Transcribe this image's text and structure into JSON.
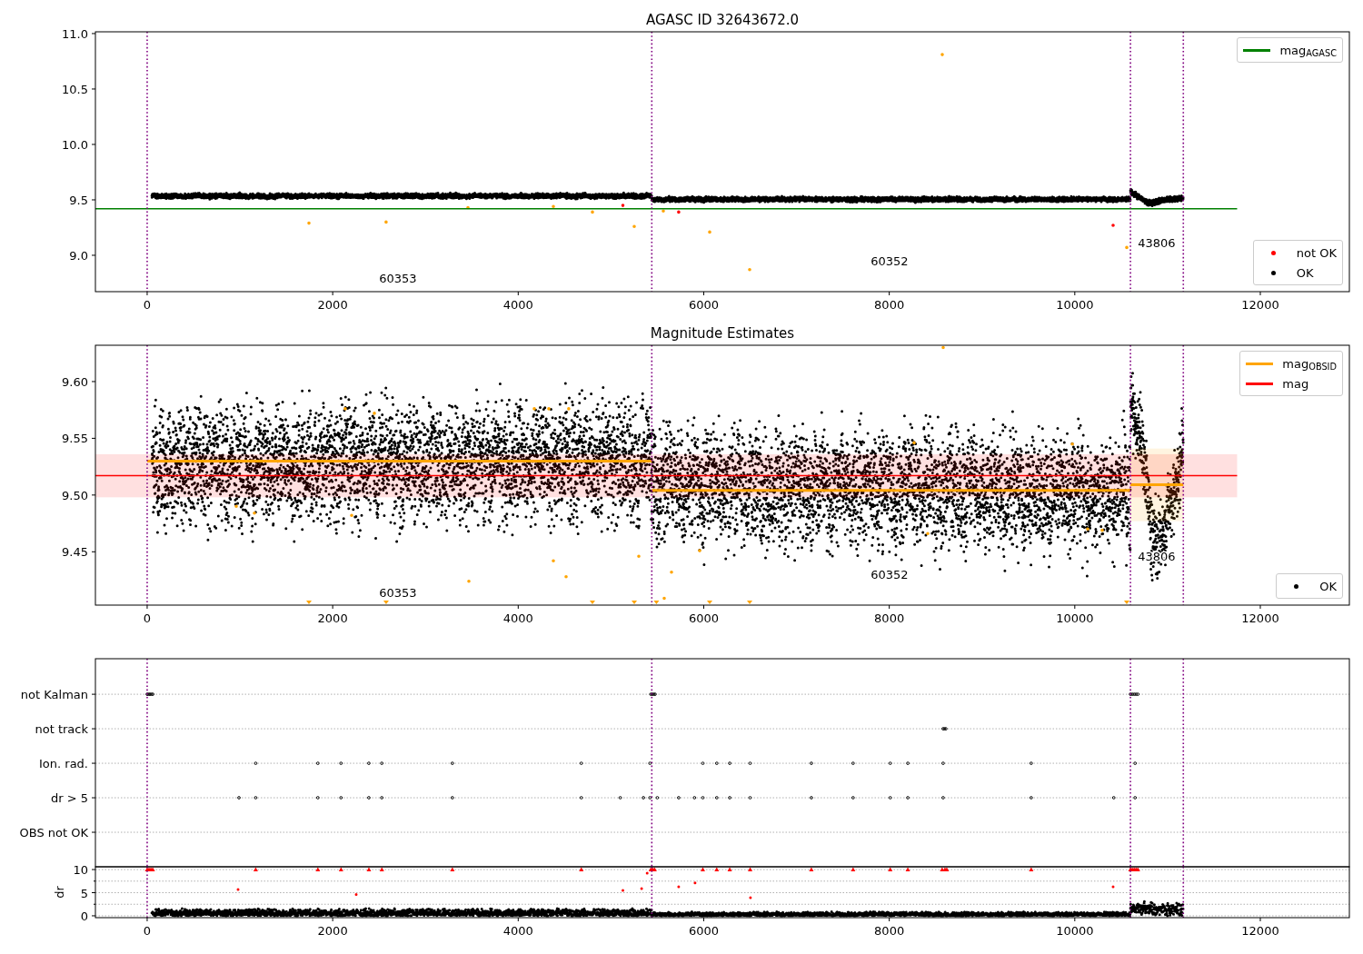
{
  "panels": [
    {
      "legends": [
        {
          "items": [
            {
              "label": "mag$_{AGASC}$",
              "color": "#008000",
              "kind": "line"
            }
          ]
        },
        {
          "items": [
            {
              "label": "not OK",
              "color": "#ff0000",
              "kind": "dot"
            },
            {
              "label": "OK",
              "color": "#000000",
              "kind": "dot"
            }
          ]
        }
      ],
      "chart_data": {
        "type": "line",
        "title": "AGASC ID 32643672.0",
        "xlim": [
          -558,
          12960
        ],
        "ylim": [
          8.672,
          11.016
        ],
        "xticks": [
          0,
          2000,
          4000,
          6000,
          8000,
          10000,
          12000
        ],
        "yticks": [
          {
            "value": 9.0,
            "label": "9.0"
          },
          {
            "value": 9.5,
            "label": "9.5"
          },
          {
            "value": 10.0,
            "label": "10.0"
          },
          {
            "value": 10.5,
            "label": "10.5"
          },
          {
            "value": 11.0,
            "label": "11.0"
          }
        ],
        "series": [
          {
            "color": "#008000",
            "x": [
              -558,
              11750
            ],
            "values": [
              9.42,
              9.42
            ]
          }
        ],
        "ref_lines": [
          {
            "axis": "x",
            "value": 0,
            "color": "#800080"
          },
          {
            "axis": "x",
            "value": 5440,
            "color": "#800080"
          },
          {
            "axis": "x",
            "value": 10600,
            "color": "#800080"
          },
          {
            "axis": "x",
            "value": 11170,
            "color": "#800080"
          }
        ],
        "annotations": [
          "60353",
          "60352",
          "43806"
        ]
      }
    },
    {
      "legends": [
        {
          "items": [
            {
              "label": "mag$_{OBSID}$",
              "color": "#ffa500",
              "kind": "line"
            },
            {
              "label": "mag",
              "color": "#ff0000",
              "kind": "line"
            }
          ]
        },
        {
          "items": [
            {
              "label": "OK",
              "color": "#000000",
              "kind": "dot"
            }
          ]
        }
      ],
      "chart_data": {
        "type": "line",
        "title": "Magnitude Estimates",
        "xlim": [
          -558,
          12960
        ],
        "ylim": [
          9.403,
          9.632
        ],
        "xticks": [
          0,
          2000,
          4000,
          6000,
          8000,
          10000,
          12000
        ],
        "yticks": [
          {
            "value": 9.45,
            "label": "9.45"
          },
          {
            "value": 9.5,
            "label": "9.50"
          },
          {
            "value": 9.55,
            "label": "9.55"
          },
          {
            "value": 9.6,
            "label": "9.60"
          }
        ],
        "series": [
          {
            "color": "#ff0000",
            "x": [
              -558,
              11750
            ],
            "values": [
              9.517,
              9.517
            ]
          },
          {
            "color": "#ffa500",
            "x": [
              0,
              5440
            ],
            "values": [
              9.53,
              9.53
            ]
          },
          {
            "color": "#ffa500",
            "x": [
              5440,
              10600
            ],
            "values": [
              9.504,
              9.504
            ]
          },
          {
            "color": "#ffa500",
            "x": [
              10600,
              11170
            ],
            "values": [
              9.509,
              9.509
            ]
          }
        ],
        "bands": [
          {
            "axis": "y",
            "from": 9.498,
            "to": 9.536,
            "color": "#ff0000"
          },
          {
            "axis": "y",
            "from": 9.477,
            "to": 9.541,
            "color": "#ffa500"
          }
        ],
        "ref_lines": [
          {
            "axis": "x",
            "value": 0,
            "color": "#800080"
          },
          {
            "axis": "x",
            "value": 5440,
            "color": "#800080"
          },
          {
            "axis": "x",
            "value": 10600,
            "color": "#800080"
          },
          {
            "axis": "x",
            "value": 11170,
            "color": "#800080"
          }
        ],
        "annotations": [
          "60353",
          "60352",
          "43806"
        ]
      }
    }
  ],
  "flags": {
    "labels": [
      "not Kalman",
      "not track",
      "Ion. rad.",
      "dr > 5",
      "OBS not OK"
    ]
  },
  "dr": {
    "label": "dr",
    "ticks": [
      "10",
      "5",
      "0"
    ],
    "xtick_labels": [
      "0",
      "2000",
      "4000",
      "6000",
      "8000",
      "10000",
      "12000"
    ]
  }
}
